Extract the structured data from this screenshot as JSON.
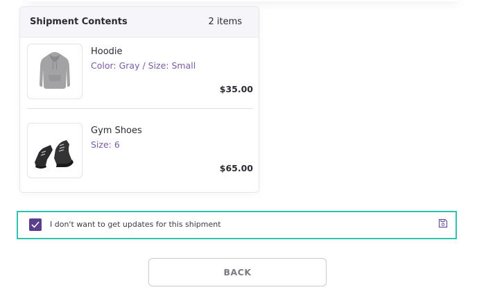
{
  "shipment": {
    "title": "Shipment Contents",
    "count": "2 items",
    "items": [
      {
        "name": "Hoodie",
        "variant": "Color: Gray / Size: Small",
        "price": "$35.00",
        "image_icon": "hoodie-icon"
      },
      {
        "name": "Gym Shoes",
        "variant": "Size: 6",
        "price": "$65.00",
        "image_icon": "shoes-icon"
      }
    ]
  },
  "optout": {
    "label": "I don't want to get updates for this shipment",
    "checked": true,
    "save_icon": "save-icon"
  },
  "actions": {
    "back_label": "BACK"
  },
  "colors": {
    "accent_purple": "#5b3e8e",
    "variant_text": "#7a5aa8",
    "highlight_border": "#2bc2b0"
  }
}
